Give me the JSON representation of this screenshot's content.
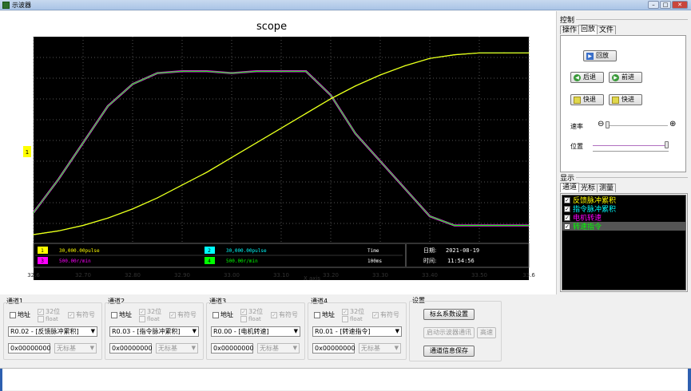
{
  "window": {
    "title": "示波器"
  },
  "scope": {
    "title": "scope",
    "x_axis_label": "X axis",
    "x_ticks": [
      "32.6",
      "32.70",
      "32.80",
      "32.90",
      "33.00",
      "33.10",
      "33.20",
      "33.30",
      "33.40",
      "33.50",
      "33.6"
    ],
    "marker_label": "1",
    "channels_readout": [
      {
        "num": "1",
        "value": "30,000.00pulse",
        "color": "#ffff00"
      },
      {
        "num": "2",
        "value": "30,000.00pulse",
        "color": "#00ffff"
      },
      {
        "num": "3",
        "value": "500.00r/min",
        "color": "#ff00ff"
      },
      {
        "num": "4",
        "value": "500.00r/min",
        "color": "#00ff00"
      }
    ],
    "time_label": "Time",
    "time_value": "100ms",
    "date_label": "日期:",
    "date_value": "2021-08-19",
    "clock_label": "时间:",
    "clock_value": "11:54:56"
  },
  "control": {
    "title": "控制",
    "tabs": [
      "操作",
      "回放",
      "文件"
    ],
    "active_tab": 1,
    "replay_label": "回放",
    "back_label": "后退",
    "forward_label": "前进",
    "fast_back_label": "快退",
    "fast_forward_label": "快进",
    "speed_label": "速率",
    "position_label": "位置"
  },
  "display": {
    "title": "显示",
    "tabs": [
      "通道",
      "光标",
      "测量"
    ],
    "items": [
      {
        "label": "反馈脉冲累积",
        "color": "#ffff00",
        "checked": true
      },
      {
        "label": "指令脉冲累积",
        "color": "#00ffff",
        "checked": true
      },
      {
        "label": "电机转速",
        "color": "#ff00ff",
        "checked": true
      },
      {
        "label": "转速指令",
        "color": "#00ff00",
        "checked": true
      }
    ]
  },
  "bottom": {
    "channels": [
      {
        "title": "通道1",
        "addr": "地址",
        "bit32": "32位",
        "float": "float",
        "signed": "有符号",
        "select": "R0.02 - [反馈脉冲累积]",
        "hex": "0x00000000",
        "scale": "无标基"
      },
      {
        "title": "通道2",
        "addr": "地址",
        "bit32": "32位",
        "float": "float",
        "signed": "有符号",
        "select": "R0.03 - [指令脉冲累积]",
        "hex": "0x00000000",
        "scale": "无标基"
      },
      {
        "title": "通道3",
        "addr": "地址",
        "bit32": "32位",
        "float": "float",
        "signed": "有符号",
        "select": "R0.00 - [电机转速]",
        "hex": "0x00000000",
        "scale": "无标基"
      },
      {
        "title": "通道4",
        "addr": "地址",
        "bit32": "32位",
        "float": "float",
        "signed": "有符号",
        "select": "R0.01 - [转速指令]",
        "hex": "0x00000000",
        "scale": "无标基"
      }
    ],
    "settings": {
      "title": "设置",
      "coef_button": "标幺系数设置",
      "start_comm_button": "启动示波器通讯",
      "hispeed_button": "高速",
      "save_button": "通道信息保存"
    }
  },
  "chart_data": {
    "type": "line",
    "title": "scope",
    "xlabel": "X axis",
    "xlim": [
      32.6,
      33.6
    ],
    "x": [
      32.6,
      32.65,
      32.7,
      32.75,
      32.8,
      32.85,
      32.9,
      32.95,
      33.0,
      33.05,
      33.1,
      33.15,
      33.2,
      33.25,
      33.3,
      33.35,
      33.4,
      33.45,
      33.5,
      33.55,
      33.6
    ],
    "series": [
      {
        "name": "反馈脉冲累积",
        "color": "#ffff00",
        "values": [
          0.0,
          0.02,
          0.05,
          0.09,
          0.14,
          0.2,
          0.27,
          0.34,
          0.42,
          0.5,
          0.58,
          0.66,
          0.74,
          0.81,
          0.87,
          0.92,
          0.96,
          0.98,
          0.99,
          0.99,
          0.99
        ]
      },
      {
        "name": "指令脉冲累积",
        "color": "#00ffff",
        "values": [
          0.0,
          0.02,
          0.05,
          0.09,
          0.14,
          0.2,
          0.27,
          0.34,
          0.42,
          0.5,
          0.58,
          0.66,
          0.74,
          0.81,
          0.87,
          0.92,
          0.96,
          0.98,
          0.99,
          0.99,
          0.99
        ]
      },
      {
        "name": "电机转速",
        "color": "#ff00ff",
        "values": [
          0.12,
          0.3,
          0.5,
          0.7,
          0.82,
          0.88,
          0.89,
          0.89,
          0.88,
          0.89,
          0.89,
          0.89,
          0.76,
          0.55,
          0.4,
          0.25,
          0.1,
          0.05,
          0.05,
          0.05,
          0.05
        ]
      },
      {
        "name": "转速指令",
        "color": "#00ff00",
        "values": [
          0.12,
          0.3,
          0.5,
          0.7,
          0.82,
          0.88,
          0.89,
          0.89,
          0.88,
          0.89,
          0.89,
          0.89,
          0.76,
          0.55,
          0.4,
          0.25,
          0.1,
          0.05,
          0.05,
          0.05,
          0.05
        ]
      }
    ],
    "grid": true
  }
}
